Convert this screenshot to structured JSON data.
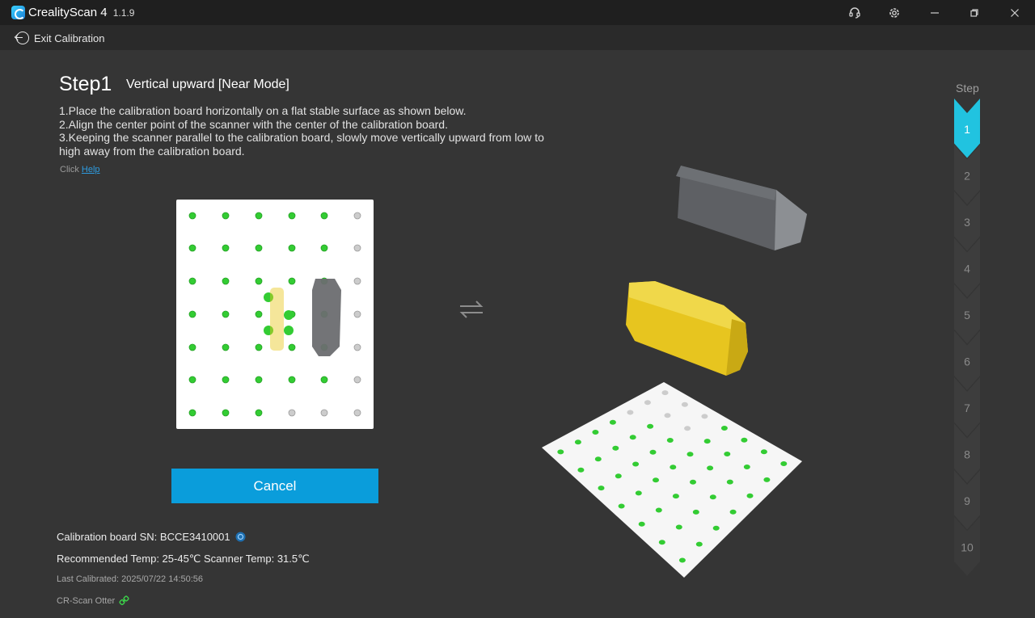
{
  "titlebar": {
    "app_name": "CrealityScan 4",
    "version": "1.1.9",
    "icons": [
      "headset-icon",
      "gear-icon",
      "minimize-icon",
      "restore-icon",
      "close-icon"
    ]
  },
  "toolbar": {
    "exit_label": "Exit Calibration"
  },
  "step": {
    "title": "Step1",
    "subtitle": "Vertical upward [Near Mode]",
    "instructions": [
      "1.Place the calibration board horizontally on a flat stable surface as shown below.",
      "2.Align the center point of the scanner with the center of the calibration board.",
      "3.Keeping the scanner parallel to the calibration board, slowly move vertically upward from low to high away from the calibration board."
    ],
    "help_prefix": "Click",
    "help_link": "Help"
  },
  "actions": {
    "cancel_label": "Cancel"
  },
  "info": {
    "board_sn": "Calibration board SN: BCCE3410001",
    "temps": "Recommended Temp: 25-45℃ Scanner Temp: 31.5℃",
    "last_calibrated": "Last Calibrated: 2025/07/22 14:50:56",
    "device": "CR-Scan Otter"
  },
  "steps_panel": {
    "label": "Step",
    "steps": [
      "1",
      "2",
      "3",
      "4",
      "5",
      "6",
      "7",
      "8",
      "9",
      "10"
    ],
    "active_index": 0
  },
  "colors": {
    "accent": "#0a9ddb",
    "active_step": "#21c3e0",
    "dot_green": "#33cc33",
    "dot_gray": "#cccccc",
    "scanner_yellow": "#e8c820"
  }
}
